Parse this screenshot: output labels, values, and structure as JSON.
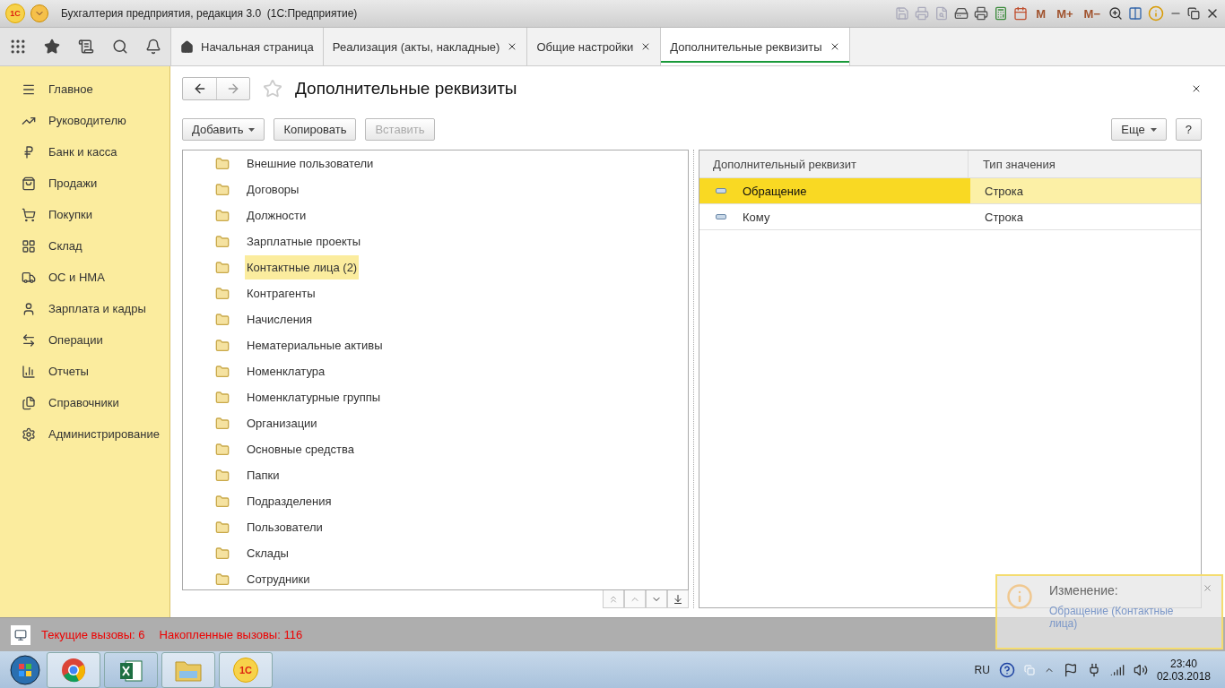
{
  "window": {
    "title": "Бухгалтерия предприятия, редакция 3.0  (1С:Предприятие)",
    "logo": "1С"
  },
  "toolbar": {
    "memory_buttons": [
      "M",
      "M+",
      "M−"
    ]
  },
  "tabs": [
    {
      "label": "Начальная страница",
      "selected": false,
      "closable": false,
      "kind": "home"
    },
    {
      "label": "Реализация (акты, накладные)",
      "selected": false,
      "closable": true,
      "kind": "plain"
    },
    {
      "label": "Общие настройки",
      "selected": false,
      "closable": true,
      "kind": "plain"
    },
    {
      "label": "Дополнительные реквизиты",
      "selected": true,
      "closable": true,
      "kind": "plain"
    }
  ],
  "sidebar": {
    "items": [
      {
        "label": "Главное"
      },
      {
        "label": "Руководителю"
      },
      {
        "label": "Банк и касса"
      },
      {
        "label": "Продажи"
      },
      {
        "label": "Покупки"
      },
      {
        "label": "Склад"
      },
      {
        "label": "ОС и НМА"
      },
      {
        "label": "Зарплата и кадры"
      },
      {
        "label": "Операции"
      },
      {
        "label": "Отчеты"
      },
      {
        "label": "Справочники"
      },
      {
        "label": "Администрирование"
      }
    ]
  },
  "form": {
    "title": "Дополнительные реквизиты",
    "buttons": [
      {
        "label": "Добавить",
        "dropdown": true,
        "disabled": false
      },
      {
        "label": "Копировать",
        "dropdown": false,
        "disabled": false
      },
      {
        "label": "Вставить",
        "dropdown": false,
        "disabled": true
      }
    ],
    "more_button": "Еще",
    "help_button": "?",
    "tree": [
      {
        "label": "Внешние пользователи",
        "selected": false
      },
      {
        "label": "Договоры",
        "selected": false
      },
      {
        "label": "Должности",
        "selected": false
      },
      {
        "label": "Зарплатные проекты",
        "selected": false
      },
      {
        "label": "Контактные лица (2)",
        "selected": true
      },
      {
        "label": "Контрагенты",
        "selected": false
      },
      {
        "label": "Начисления",
        "selected": false
      },
      {
        "label": "Нематериальные активы",
        "selected": false
      },
      {
        "label": "Номенклатура",
        "selected": false
      },
      {
        "label": "Номенклатурные группы",
        "selected": false
      },
      {
        "label": "Организации",
        "selected": false
      },
      {
        "label": "Основные средства",
        "selected": false
      },
      {
        "label": "Папки",
        "selected": false
      },
      {
        "label": "Подразделения",
        "selected": false
      },
      {
        "label": "Пользователи",
        "selected": false
      },
      {
        "label": "Склады",
        "selected": false
      },
      {
        "label": "Сотрудники",
        "selected": false
      }
    ],
    "table": {
      "columns": [
        "Дополнительный реквизит",
        "Тип значения"
      ],
      "rows": [
        {
          "name": "Обращение",
          "type": "Строка",
          "selected": true
        },
        {
          "name": "Кому",
          "type": "Строка",
          "selected": false
        }
      ]
    }
  },
  "status_bar": {
    "current_calls": "Текущие вызовы: 6",
    "total_calls": "Накопленные вызовы: 116"
  },
  "notification": {
    "title": "Изменение:",
    "text": "Обращение (Контактные лица)"
  },
  "taskbar": {
    "language": "RU",
    "time": "23:40",
    "date": "02.03.2018",
    "logo": "1С"
  }
}
